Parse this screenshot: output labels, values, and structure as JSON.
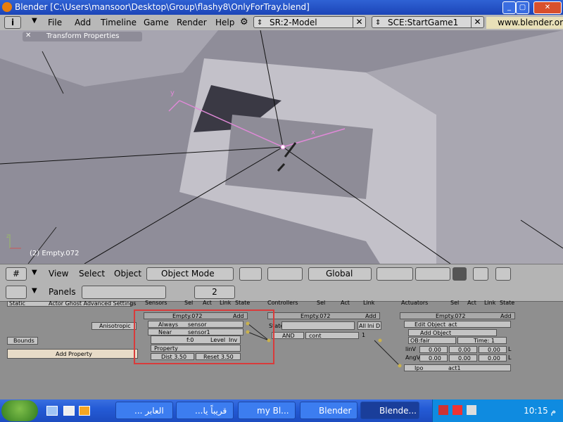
{
  "window": {
    "title": "Blender [C:\\Users\\mansoor\\Desktop\\Group\\flashy8\\OnlyForTray.blend]"
  },
  "menu": {
    "items": [
      "File",
      "Add",
      "Timeline",
      "Game",
      "Render",
      "Help"
    ]
  },
  "screen_field": {
    "value": "SR:2-Model"
  },
  "scene_field": {
    "value": "SCE:StartGame1"
  },
  "url": "www.blender.or",
  "viewport": {
    "panel_title": "Transform Properties",
    "object_label": "(2) Empty.072",
    "axis_y": "y",
    "axis_x": "x",
    "axis_z": "z"
  },
  "view3d_header": {
    "view": "View",
    "select": "Select",
    "object": "Object",
    "mode": "Object Mode",
    "orientation": "Global"
  },
  "buttons_header": {
    "panels": "Panels",
    "page": "2"
  },
  "logic": {
    "left": {
      "static": "Static",
      "actor_row": "Actor Ghost Advanced Settings",
      "anisotropic": "Anisotropic",
      "bounds": "Bounds",
      "add_property": "Add Property"
    },
    "sensors": {
      "title": "Sensors",
      "sel": "Sel",
      "act": "Act",
      "link": "Link",
      "state": "State",
      "object": "Empty.072",
      "add": "Add",
      "s1_type": "Always",
      "s1_name": "sensor",
      "s2_type": "Near",
      "s2_name": "sensor1",
      "f": "f:0",
      "level": "Level",
      "inv": "Inv",
      "property": "Property",
      "dist": "Dist 3.50",
      "reset": "Reset 3.50"
    },
    "controllers": {
      "title": "Controllers",
      "sel": "Sel",
      "act": "Act",
      "link": "Link",
      "object": "Empty.072",
      "add": "Add",
      "state": "State",
      "all": "All",
      "ini": "Ini",
      "d": "D",
      "type": "AND",
      "name": "cont",
      "num": "1"
    },
    "actuators": {
      "title": "Actuators",
      "sel": "Sel",
      "act": "Act",
      "link": "Link",
      "state": "State",
      "object": "Empty.072",
      "add": "Add",
      "type": "Edit Object",
      "name": "act",
      "mode": "Add Object",
      "ob": "OB:fair",
      "time": "Time: 1",
      "linv": "linV",
      "angv": "AngV",
      "zero": "0.00",
      "l": "L",
      "ipo": "Ipo",
      "act1": "act1"
    }
  },
  "taskbar": {
    "tasks": [
      "... العابر",
      "...قريباً يا",
      "my Bl...",
      "Blender",
      "Blende..."
    ],
    "clock": "10:15 م"
  },
  "colors": {
    "highlight": "#d93b3b",
    "viewport": "#9d9ba6"
  }
}
